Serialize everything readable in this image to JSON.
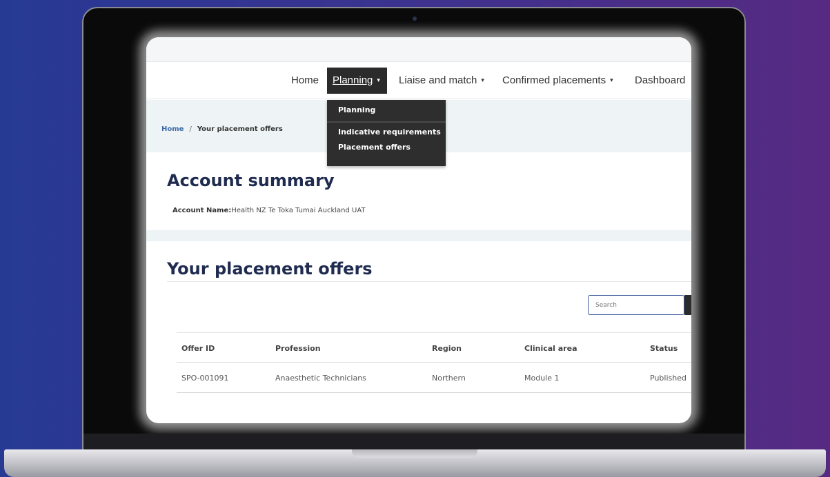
{
  "nav": {
    "home": "Home",
    "planning": "Planning",
    "liaise": "Liaise and match",
    "confirmed": "Confirmed placements",
    "dashboard": "Dashboard",
    "caret": "▾"
  },
  "dropdown": {
    "planning": "Planning",
    "indicative": "Indicative requirements",
    "offers": "Placement offers"
  },
  "breadcrumb": {
    "home": "Home",
    "separator": "/",
    "current": "Your placement offers"
  },
  "account": {
    "title": "Account summary",
    "name_label": "Account Name:",
    "name_value": "Health NZ Te Toka Tumai Auckland UAT"
  },
  "offers": {
    "title": "Your placement offers",
    "search_placeholder": "Search",
    "columns": [
      "Offer ID",
      "Profession",
      "Region",
      "Clinical area",
      "Status"
    ],
    "rows": [
      [
        "SPO-001091",
        "Anaesthetic Technicians",
        "Northern",
        "Module 1",
        "Published"
      ]
    ]
  },
  "colors": {
    "background_left": "#263a94",
    "background_right": "#572a82",
    "nav_active": "#2b2b2b",
    "heading": "#1f2b4f",
    "link": "#3b6aa8",
    "band": "#eef4f5"
  }
}
